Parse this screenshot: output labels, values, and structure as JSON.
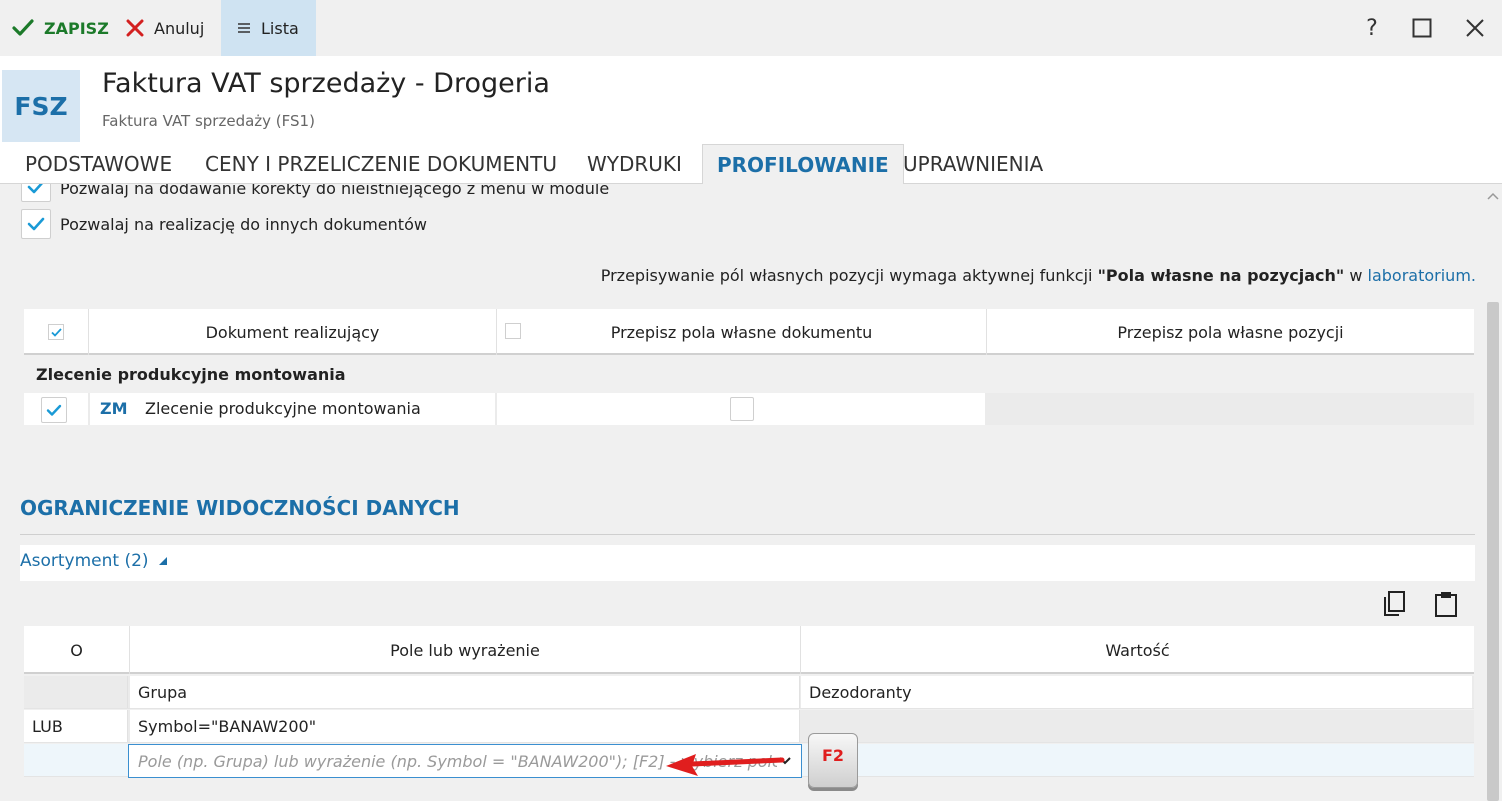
{
  "toolbar": {
    "save_label": "ZAPISZ",
    "cancel_label": "Anuluj",
    "list_label": "Lista",
    "help_label": "?"
  },
  "header": {
    "badge": "FSZ",
    "title": "Faktura VAT sprzedaży - Drogeria",
    "subtitle": "Faktura VAT sprzedaży (FS1)"
  },
  "tabs": [
    {
      "label": "PODSTAWOWE",
      "active": false
    },
    {
      "label": "CENY I PRZELICZENIE DOKUMENTU",
      "active": false
    },
    {
      "label": "WYDRUKI",
      "active": false
    },
    {
      "label": "PROFILOWANIE",
      "active": true
    },
    {
      "label": "UPRAWNIENIA",
      "active": false
    }
  ],
  "options": {
    "opt1_label": "Pozwalaj na dodawanie korekty do nieistniejącego z menu w module",
    "opt2_label": "Pozwalaj na realizację do innych dokumentów"
  },
  "info": {
    "prefix": "Przepisywanie pól własnych pozycji wymaga aktywnej funkcji ",
    "bold": "\"Pola własne na pozycjach\"",
    "middle": " w ",
    "link": "laboratorium."
  },
  "grid1": {
    "headers": [
      "Dokument realizujący",
      "Przepisz pola własne dokumentu",
      "Przepisz pola własne pozycji"
    ],
    "group": "Zlecenie produkcyjne montowania",
    "row": {
      "code": "ZM",
      "name": "Zlecenie produkcyjne montowania"
    }
  },
  "section": {
    "title": "OGRANICZENIE WIDOCZNOŚCI DANYCH",
    "asortyment_link": "Asortyment (2)"
  },
  "grid2": {
    "headers": [
      "O",
      "Pole lub wyrażenie",
      "Wartość"
    ],
    "rows": [
      {
        "op": "",
        "field": "Grupa",
        "value": "Dezodoranty"
      },
      {
        "op": "LUB",
        "field": "Symbol=\"BANAW200\"",
        "value": ""
      }
    ],
    "edit_placeholder": "Pole (np. Grupa) lub wyrażenie (np. Symbol = \"BANAW200\"); [F2] - wybierz pole"
  },
  "key_hint": "F2",
  "colors": {
    "accent": "#1c6fa8",
    "save_green": "#1c7a2a",
    "cancel_red": "#d32020",
    "check_blue": "#1a9ad6"
  }
}
